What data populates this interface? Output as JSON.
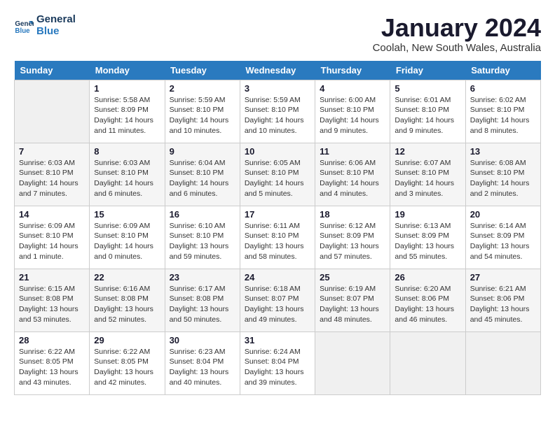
{
  "header": {
    "logo_line1": "General",
    "logo_line2": "Blue",
    "month": "January 2024",
    "location": "Coolah, New South Wales, Australia"
  },
  "weekdays": [
    "Sunday",
    "Monday",
    "Tuesday",
    "Wednesday",
    "Thursday",
    "Friday",
    "Saturday"
  ],
  "weeks": [
    [
      {
        "day": "",
        "sunrise": "",
        "sunset": "",
        "daylight": ""
      },
      {
        "day": "1",
        "sunrise": "Sunrise: 5:58 AM",
        "sunset": "Sunset: 8:09 PM",
        "daylight": "Daylight: 14 hours and 11 minutes."
      },
      {
        "day": "2",
        "sunrise": "Sunrise: 5:59 AM",
        "sunset": "Sunset: 8:10 PM",
        "daylight": "Daylight: 14 hours and 10 minutes."
      },
      {
        "day": "3",
        "sunrise": "Sunrise: 5:59 AM",
        "sunset": "Sunset: 8:10 PM",
        "daylight": "Daylight: 14 hours and 10 minutes."
      },
      {
        "day": "4",
        "sunrise": "Sunrise: 6:00 AM",
        "sunset": "Sunset: 8:10 PM",
        "daylight": "Daylight: 14 hours and 9 minutes."
      },
      {
        "day": "5",
        "sunrise": "Sunrise: 6:01 AM",
        "sunset": "Sunset: 8:10 PM",
        "daylight": "Daylight: 14 hours and 9 minutes."
      },
      {
        "day": "6",
        "sunrise": "Sunrise: 6:02 AM",
        "sunset": "Sunset: 8:10 PM",
        "daylight": "Daylight: 14 hours and 8 minutes."
      }
    ],
    [
      {
        "day": "7",
        "sunrise": "Sunrise: 6:03 AM",
        "sunset": "Sunset: 8:10 PM",
        "daylight": "Daylight: 14 hours and 7 minutes."
      },
      {
        "day": "8",
        "sunrise": "Sunrise: 6:03 AM",
        "sunset": "Sunset: 8:10 PM",
        "daylight": "Daylight: 14 hours and 6 minutes."
      },
      {
        "day": "9",
        "sunrise": "Sunrise: 6:04 AM",
        "sunset": "Sunset: 8:10 PM",
        "daylight": "Daylight: 14 hours and 6 minutes."
      },
      {
        "day": "10",
        "sunrise": "Sunrise: 6:05 AM",
        "sunset": "Sunset: 8:10 PM",
        "daylight": "Daylight: 14 hours and 5 minutes."
      },
      {
        "day": "11",
        "sunrise": "Sunrise: 6:06 AM",
        "sunset": "Sunset: 8:10 PM",
        "daylight": "Daylight: 14 hours and 4 minutes."
      },
      {
        "day": "12",
        "sunrise": "Sunrise: 6:07 AM",
        "sunset": "Sunset: 8:10 PM",
        "daylight": "Daylight: 14 hours and 3 minutes."
      },
      {
        "day": "13",
        "sunrise": "Sunrise: 6:08 AM",
        "sunset": "Sunset: 8:10 PM",
        "daylight": "Daylight: 14 hours and 2 minutes."
      }
    ],
    [
      {
        "day": "14",
        "sunrise": "Sunrise: 6:09 AM",
        "sunset": "Sunset: 8:10 PM",
        "daylight": "Daylight: 14 hours and 1 minute."
      },
      {
        "day": "15",
        "sunrise": "Sunrise: 6:09 AM",
        "sunset": "Sunset: 8:10 PM",
        "daylight": "Daylight: 14 hours and 0 minutes."
      },
      {
        "day": "16",
        "sunrise": "Sunrise: 6:10 AM",
        "sunset": "Sunset: 8:10 PM",
        "daylight": "Daylight: 13 hours and 59 minutes."
      },
      {
        "day": "17",
        "sunrise": "Sunrise: 6:11 AM",
        "sunset": "Sunset: 8:10 PM",
        "daylight": "Daylight: 13 hours and 58 minutes."
      },
      {
        "day": "18",
        "sunrise": "Sunrise: 6:12 AM",
        "sunset": "Sunset: 8:09 PM",
        "daylight": "Daylight: 13 hours and 57 minutes."
      },
      {
        "day": "19",
        "sunrise": "Sunrise: 6:13 AM",
        "sunset": "Sunset: 8:09 PM",
        "daylight": "Daylight: 13 hours and 55 minutes."
      },
      {
        "day": "20",
        "sunrise": "Sunrise: 6:14 AM",
        "sunset": "Sunset: 8:09 PM",
        "daylight": "Daylight: 13 hours and 54 minutes."
      }
    ],
    [
      {
        "day": "21",
        "sunrise": "Sunrise: 6:15 AM",
        "sunset": "Sunset: 8:08 PM",
        "daylight": "Daylight: 13 hours and 53 minutes."
      },
      {
        "day": "22",
        "sunrise": "Sunrise: 6:16 AM",
        "sunset": "Sunset: 8:08 PM",
        "daylight": "Daylight: 13 hours and 52 minutes."
      },
      {
        "day": "23",
        "sunrise": "Sunrise: 6:17 AM",
        "sunset": "Sunset: 8:08 PM",
        "daylight": "Daylight: 13 hours and 50 minutes."
      },
      {
        "day": "24",
        "sunrise": "Sunrise: 6:18 AM",
        "sunset": "Sunset: 8:07 PM",
        "daylight": "Daylight: 13 hours and 49 minutes."
      },
      {
        "day": "25",
        "sunrise": "Sunrise: 6:19 AM",
        "sunset": "Sunset: 8:07 PM",
        "daylight": "Daylight: 13 hours and 48 minutes."
      },
      {
        "day": "26",
        "sunrise": "Sunrise: 6:20 AM",
        "sunset": "Sunset: 8:06 PM",
        "daylight": "Daylight: 13 hours and 46 minutes."
      },
      {
        "day": "27",
        "sunrise": "Sunrise: 6:21 AM",
        "sunset": "Sunset: 8:06 PM",
        "daylight": "Daylight: 13 hours and 45 minutes."
      }
    ],
    [
      {
        "day": "28",
        "sunrise": "Sunrise: 6:22 AM",
        "sunset": "Sunset: 8:05 PM",
        "daylight": "Daylight: 13 hours and 43 minutes."
      },
      {
        "day": "29",
        "sunrise": "Sunrise: 6:22 AM",
        "sunset": "Sunset: 8:05 PM",
        "daylight": "Daylight: 13 hours and 42 minutes."
      },
      {
        "day": "30",
        "sunrise": "Sunrise: 6:23 AM",
        "sunset": "Sunset: 8:04 PM",
        "daylight": "Daylight: 13 hours and 40 minutes."
      },
      {
        "day": "31",
        "sunrise": "Sunrise: 6:24 AM",
        "sunset": "Sunset: 8:04 PM",
        "daylight": "Daylight: 13 hours and 39 minutes."
      },
      {
        "day": "",
        "sunrise": "",
        "sunset": "",
        "daylight": ""
      },
      {
        "day": "",
        "sunrise": "",
        "sunset": "",
        "daylight": ""
      },
      {
        "day": "",
        "sunrise": "",
        "sunset": "",
        "daylight": ""
      }
    ]
  ]
}
